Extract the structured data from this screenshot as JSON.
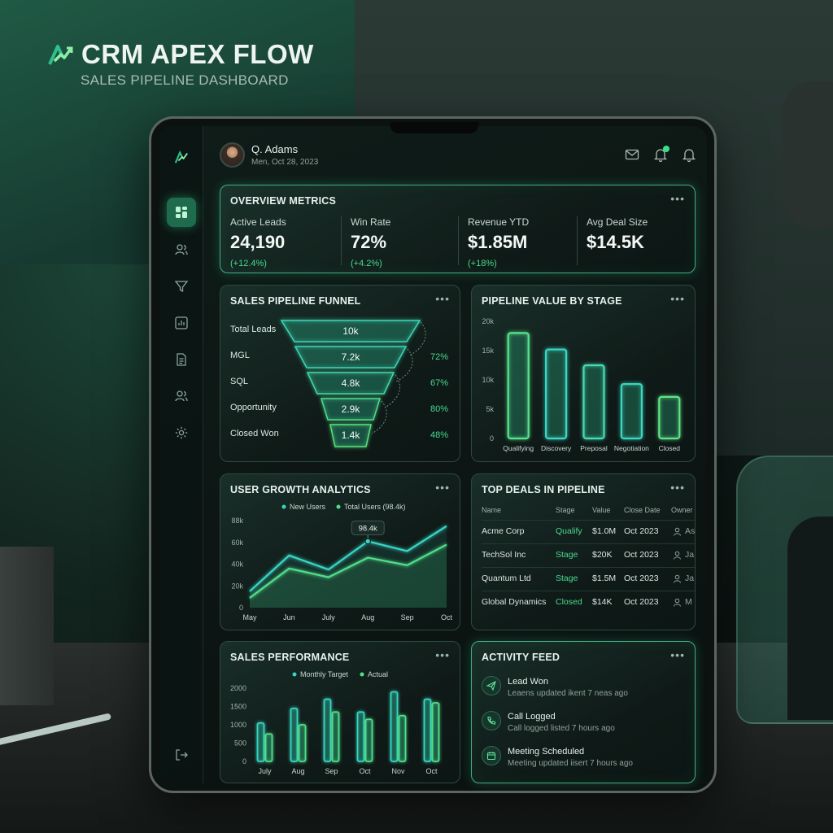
{
  "brand": {
    "title": "CRM APEX FLOW",
    "subtitle": "SALES PIPELINE DASHBOARD"
  },
  "user": {
    "name": "Q. Adams",
    "date": "Men, Oct 28, 2023"
  },
  "overview": {
    "title": "OVERVIEW METRICS",
    "metrics": [
      {
        "label": "Active Leads",
        "value": "24,190",
        "change": "(+12.4%)"
      },
      {
        "label": "Win Rate",
        "value": "72%",
        "change": "(+4.2%)"
      },
      {
        "label": "Revenue YTD",
        "value": "$1.85M",
        "change": "(+18%)"
      },
      {
        "label": "Avg Deal Size",
        "value": "$14.5K",
        "change": ""
      }
    ]
  },
  "funnel": {
    "title": "SALES PIPELINE FUNNEL",
    "stages": [
      {
        "label": "Total Leads",
        "value": "10k",
        "rate": ""
      },
      {
        "label": "MGL",
        "value": "7.2k",
        "rate": "72%"
      },
      {
        "label": "SQL",
        "value": "4.8k",
        "rate": "67%"
      },
      {
        "label": "Opportunity",
        "value": "2.9k",
        "rate": "80%"
      },
      {
        "label": "Closed Won",
        "value": "1.4k",
        "rate": "48%"
      }
    ]
  },
  "chart_data": [
    {
      "type": "bar",
      "title": "PIPELINE VALUE BY STAGE",
      "categories": [
        "Qualifying",
        "Discovery",
        "Preposal",
        "Negotiation",
        "Closed"
      ],
      "values": [
        18000,
        15200,
        12500,
        9300,
        7100
      ],
      "yticks": [
        "20k",
        "15k",
        "10k",
        "5k",
        "0"
      ],
      "ylim": [
        0,
        20000
      ]
    },
    {
      "type": "line",
      "title": "USER GROWTH ANALYTICS",
      "x": [
        "May",
        "Jun",
        "July",
        "Aug",
        "Sep",
        "Oct"
      ],
      "yticks": [
        "88k",
        "60k",
        "40k",
        "20k",
        "0"
      ],
      "ylim": [
        0,
        80000
      ],
      "series": [
        {
          "name": "New Users",
          "values": [
            15000,
            48000,
            35000,
            61000,
            52000,
            75000
          ]
        },
        {
          "name": "Total Users (98.4k)",
          "values": [
            9000,
            36000,
            28000,
            46000,
            39000,
            58000
          ]
        }
      ],
      "annotation": {
        "label": "98.4k",
        "x": "Aug",
        "value": 61000
      }
    },
    {
      "type": "bar",
      "title": "SALES PERFORMANCE",
      "categories": [
        "July",
        "Aug",
        "Sep",
        "Oct",
        "Nov",
        "Oct"
      ],
      "yticks": [
        "2000",
        "1500",
        "1000",
        "500",
        "0"
      ],
      "ylim": [
        0,
        2000
      ],
      "series": [
        {
          "name": "Monthly Target",
          "values": [
            1050,
            1450,
            1700,
            1350,
            1900,
            1700
          ]
        },
        {
          "name": "Actual",
          "values": [
            750,
            1000,
            1350,
            1150,
            1250,
            1600
          ]
        }
      ]
    }
  ],
  "deals": {
    "title": "TOP DEALS IN PIPELINE",
    "columns": [
      "Name",
      "Stage",
      "Value",
      "Close Date",
      "Owner"
    ],
    "rows": [
      {
        "name": "Acme Corp",
        "stage": "Qualify",
        "value": "$1.0M",
        "date": "Oct 2023",
        "owner": "As"
      },
      {
        "name": "TechSol Inc",
        "stage": "Stage",
        "value": "$20K",
        "date": "Oct 2023",
        "owner": "Ja"
      },
      {
        "name": "Quantum Ltd",
        "stage": "Stage",
        "value": "$1.5M",
        "date": "Oct 2023",
        "owner": "Ja"
      },
      {
        "name": "Global Dynamics",
        "stage": "Closed",
        "value": "$14K",
        "date": "Oct 2023",
        "owner": "M"
      }
    ]
  },
  "activity": {
    "title": "ACTIVITY FEED",
    "items": [
      {
        "title": "Lead Won",
        "desc": "Leaens updated ikent 7 neas ago",
        "icon": "paper-plane-icon"
      },
      {
        "title": "Call Logged",
        "desc": "Call logged listed 7 hours ago",
        "icon": "phone-icon"
      },
      {
        "title": "Meeting Scheduled",
        "desc": "Meeting updated iisert 7 hours ago",
        "icon": "calendar-icon"
      }
    ]
  },
  "menu_dots": "•••",
  "colors": {
    "accent": "#3ee08f",
    "teal": "#37d6c4",
    "bg": "#0d1614"
  }
}
